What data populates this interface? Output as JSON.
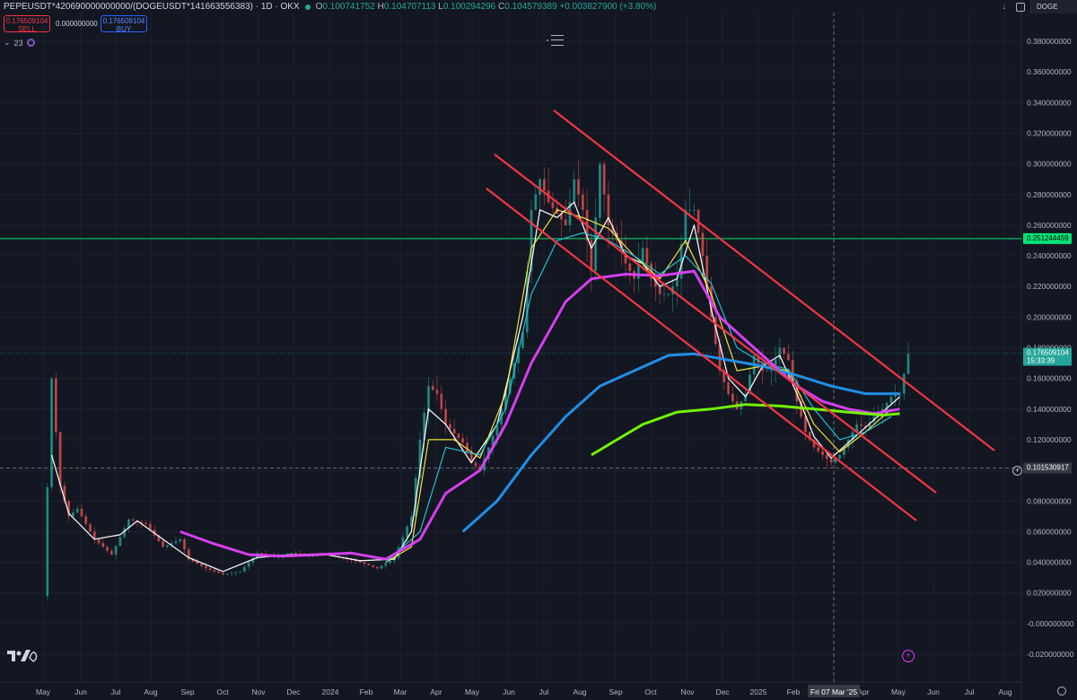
{
  "header": {
    "symbol": "PEPEUSDT*420690000000000/(DOGEUSDT*141663556383) · 1D · OKX",
    "open_label": "O",
    "open_value": "0.100741752",
    "high_label": "H",
    "high_value": "0.104707113",
    "low_label": "L",
    "low_value": "0.100294296",
    "close_label": "C",
    "close_value": "0.104579389",
    "change": "+0.003827900 (+3.80%)"
  },
  "trade": {
    "sell_price": "0.176509104",
    "sell_label": "SELL",
    "spread": "0.000000000",
    "buy_price": "0.176509104",
    "buy_label": "BUY"
  },
  "indicators": {
    "count": "23"
  },
  "topbar": {
    "currency": "DOGE"
  },
  "colors": {
    "background": "#131722",
    "grid": "#1e2230",
    "up": "#26a69a",
    "down": "#ef5350",
    "trendline": "#f23645",
    "horizontal": "#00e676",
    "last_price_tag": "#26a69a",
    "crosshair_tag": "#363a45"
  },
  "chart_data": {
    "type": "line",
    "y_axis": {
      "min": -0.02,
      "max": 0.38,
      "ticks": [
        "0.380000000",
        "0.360000000",
        "0.340000000",
        "0.320000000",
        "0.300000000",
        "0.280000000",
        "0.260000000",
        "0.240000000",
        "0.220000000",
        "0.200000000",
        "0.180000000",
        "0.160000000",
        "0.140000000",
        "0.120000000",
        "0.100000000",
        "0.080000000",
        "0.060000000",
        "0.040000000",
        "0.020000000",
        "-0.000000000",
        "-0.020000000"
      ]
    },
    "x_axis": {
      "labels": [
        "May",
        "Jun",
        "Jul",
        "Aug",
        "Sep",
        "Oct",
        "Nov",
        "Dec",
        "2024",
        "Feb",
        "Mar",
        "Apr",
        "May",
        "Jun",
        "Jul",
        "Aug",
        "Sep",
        "Oct",
        "Nov",
        "Dec",
        "2025",
        "Feb",
        "Apr",
        "May",
        "Jun",
        "Jul",
        "Aug"
      ],
      "crosshair_label": "Fri 07 Mar '25"
    },
    "price_labels": {
      "horizontal_level": "0.251244459",
      "last_price": "0.176509104",
      "countdown": "15:33:39",
      "crosshair_price": "0.101530917"
    },
    "levels": {
      "horizontal": 0.2512,
      "last": 0.1765,
      "crosshair": 0.1015
    },
    "price_series": [
      [
        0,
        0.018
      ],
      [
        1,
        0.16
      ],
      [
        2,
        0.09
      ],
      [
        3,
        0.07
      ],
      [
        4,
        0.075
      ],
      [
        6,
        0.055
      ],
      [
        8,
        0.045
      ],
      [
        10,
        0.068
      ],
      [
        12,
        0.065
      ],
      [
        14,
        0.05
      ],
      [
        16,
        0.055
      ],
      [
        17,
        0.042
      ],
      [
        19,
        0.036
      ],
      [
        21,
        0.032
      ],
      [
        23,
        0.034
      ],
      [
        25,
        0.046
      ],
      [
        27,
        0.044
      ],
      [
        29,
        0.046
      ],
      [
        31,
        0.044
      ],
      [
        33,
        0.045
      ],
      [
        35,
        0.043
      ],
      [
        37,
        0.04
      ],
      [
        39,
        0.036
      ],
      [
        41,
        0.043
      ],
      [
        43,
        0.07
      ],
      [
        44,
        0.12
      ],
      [
        45,
        0.155
      ],
      [
        46,
        0.15
      ],
      [
        47,
        0.13
      ],
      [
        49,
        0.118
      ],
      [
        50,
        0.105
      ],
      [
        51,
        0.1
      ],
      [
        53,
        0.13
      ],
      [
        54,
        0.15
      ],
      [
        56,
        0.19
      ],
      [
        57,
        0.27
      ],
      [
        58,
        0.29
      ],
      [
        59,
        0.275
      ],
      [
        61,
        0.26
      ],
      [
        62,
        0.29
      ],
      [
        63,
        0.27
      ],
      [
        64,
        0.23
      ],
      [
        65,
        0.3
      ],
      [
        66,
        0.26
      ],
      [
        67,
        0.25
      ],
      [
        68,
        0.235
      ],
      [
        69,
        0.225
      ],
      [
        70,
        0.245
      ],
      [
        71,
        0.225
      ],
      [
        72,
        0.215
      ],
      [
        73,
        0.215
      ],
      [
        74,
        0.225
      ],
      [
        75,
        0.27
      ],
      [
        76,
        0.27
      ],
      [
        77,
        0.24
      ],
      [
        78,
        0.2
      ],
      [
        79,
        0.165
      ],
      [
        80,
        0.15
      ],
      [
        81,
        0.14
      ],
      [
        82,
        0.15
      ],
      [
        83,
        0.175
      ],
      [
        84,
        0.165
      ],
      [
        85,
        0.165
      ],
      [
        86,
        0.18
      ],
      [
        87,
        0.172
      ],
      [
        88,
        0.145
      ],
      [
        89,
        0.125
      ],
      [
        90,
        0.115
      ],
      [
        91,
        0.11
      ],
      [
        92,
        0.105
      ],
      [
        93,
        0.11
      ],
      [
        94,
        0.12
      ],
      [
        95,
        0.13
      ],
      [
        96,
        0.128
      ],
      [
        97,
        0.135
      ],
      [
        98,
        0.14
      ],
      [
        99,
        0.148
      ],
      [
        100,
        0.15
      ],
      [
        101,
        0.176
      ]
    ],
    "moving_averages": [
      {
        "color": "#ffffff",
        "values": [
          [
            1,
            0.11
          ],
          [
            3,
            0.072
          ],
          [
            6,
            0.055
          ],
          [
            9,
            0.058
          ],
          [
            11,
            0.067
          ],
          [
            14,
            0.055
          ],
          [
            17,
            0.043
          ],
          [
            21,
            0.034
          ],
          [
            25,
            0.043
          ],
          [
            29,
            0.045
          ],
          [
            33,
            0.045
          ],
          [
            37,
            0.041
          ],
          [
            41,
            0.042
          ],
          [
            43,
            0.06
          ],
          [
            45,
            0.14
          ],
          [
            47,
            0.13
          ],
          [
            50,
            0.105
          ],
          [
            53,
            0.13
          ],
          [
            56,
            0.2
          ],
          [
            58,
            0.27
          ],
          [
            60,
            0.265
          ],
          [
            62,
            0.275
          ],
          [
            64,
            0.245
          ],
          [
            66,
            0.265
          ],
          [
            68,
            0.24
          ],
          [
            70,
            0.235
          ],
          [
            72,
            0.22
          ],
          [
            74,
            0.225
          ],
          [
            76,
            0.26
          ],
          [
            78,
            0.205
          ],
          [
            80,
            0.16
          ],
          [
            82,
            0.148
          ],
          [
            84,
            0.168
          ],
          [
            86,
            0.175
          ],
          [
            88,
            0.15
          ],
          [
            90,
            0.122
          ],
          [
            92,
            0.108
          ],
          [
            94,
            0.118
          ],
          [
            96,
            0.128
          ],
          [
            98,
            0.138
          ],
          [
            100,
            0.148
          ]
        ]
      },
      {
        "color": "#ffeb3b",
        "values": [
          [
            40,
            0.04
          ],
          [
            43,
            0.05
          ],
          [
            45,
            0.12
          ],
          [
            48,
            0.12
          ],
          [
            51,
            0.108
          ],
          [
            54,
            0.15
          ],
          [
            57,
            0.245
          ],
          [
            60,
            0.27
          ],
          [
            63,
            0.265
          ],
          [
            66,
            0.258
          ],
          [
            69,
            0.24
          ],
          [
            72,
            0.225
          ],
          [
            75,
            0.25
          ],
          [
            78,
            0.215
          ],
          [
            81,
            0.165
          ],
          [
            84,
            0.168
          ],
          [
            87,
            0.165
          ],
          [
            90,
            0.13
          ],
          [
            93,
            0.112
          ],
          [
            96,
            0.125
          ],
          [
            99,
            0.14
          ]
        ]
      },
      {
        "color": "#26c6da",
        "values": [
          [
            40,
            0.04
          ],
          [
            44,
            0.06
          ],
          [
            47,
            0.115
          ],
          [
            51,
            0.11
          ],
          [
            54,
            0.14
          ],
          [
            57,
            0.215
          ],
          [
            60,
            0.25
          ],
          [
            63,
            0.255
          ],
          [
            66,
            0.25
          ],
          [
            69,
            0.24
          ],
          [
            72,
            0.228
          ],
          [
            75,
            0.24
          ],
          [
            78,
            0.222
          ],
          [
            81,
            0.18
          ],
          [
            84,
            0.17
          ],
          [
            87,
            0.166
          ],
          [
            90,
            0.14
          ],
          [
            93,
            0.12
          ],
          [
            96,
            0.125
          ],
          [
            99,
            0.135
          ]
        ]
      },
      {
        "color": "#e040fb",
        "values": [
          [
            16,
            0.06
          ],
          [
            20,
            0.052
          ],
          [
            24,
            0.045
          ],
          [
            28,
            0.044
          ],
          [
            32,
            0.045
          ],
          [
            36,
            0.046
          ],
          [
            40,
            0.042
          ],
          [
            44,
            0.055
          ],
          [
            47,
            0.085
          ],
          [
            51,
            0.1
          ],
          [
            54,
            0.13
          ],
          [
            57,
            0.17
          ],
          [
            61,
            0.21
          ],
          [
            64,
            0.225
          ],
          [
            68,
            0.228
          ],
          [
            72,
            0.227
          ],
          [
            76,
            0.23
          ],
          [
            79,
            0.2
          ],
          [
            82,
            0.185
          ],
          [
            85,
            0.17
          ],
          [
            88,
            0.155
          ],
          [
            91,
            0.145
          ],
          [
            94,
            0.14
          ],
          [
            97,
            0.137
          ],
          [
            100,
            0.14
          ]
        ]
      },
      {
        "color": "#2196f3",
        "values": [
          [
            49,
            0.06
          ],
          [
            53,
            0.08
          ],
          [
            57,
            0.11
          ],
          [
            61,
            0.135
          ],
          [
            65,
            0.155
          ],
          [
            69,
            0.165
          ],
          [
            73,
            0.175
          ],
          [
            76,
            0.176
          ],
          [
            80,
            0.172
          ],
          [
            84,
            0.168
          ],
          [
            88,
            0.162
          ],
          [
            92,
            0.155
          ],
          [
            96,
            0.15
          ],
          [
            100,
            0.15
          ]
        ]
      },
      {
        "color": "#76ff03",
        "values": [
          [
            64,
            0.11
          ],
          [
            67,
            0.12
          ],
          [
            70,
            0.13
          ],
          [
            74,
            0.138
          ],
          [
            78,
            0.14
          ],
          [
            82,
            0.143
          ],
          [
            86,
            0.142
          ],
          [
            90,
            0.14
          ],
          [
            94,
            0.138
          ],
          [
            98,
            0.136
          ],
          [
            100,
            0.137
          ]
        ]
      }
    ]
  }
}
